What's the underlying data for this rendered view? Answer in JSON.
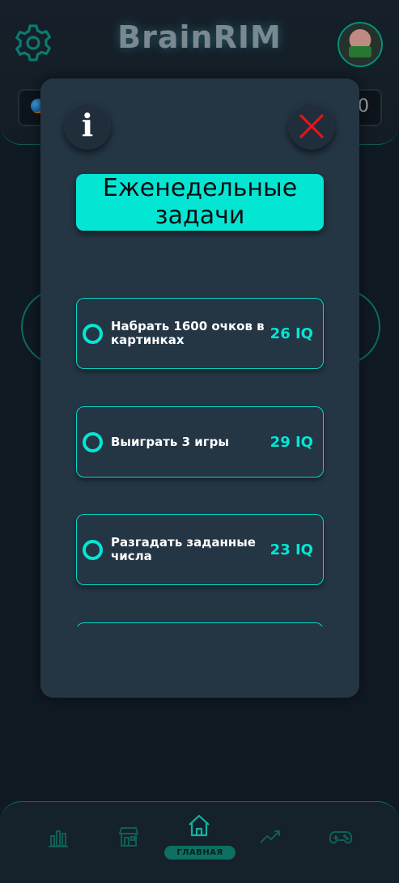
{
  "app": {
    "title": "BrainRIM"
  },
  "header": {
    "settings_icon": "gear-icon",
    "stat_right_value": "0"
  },
  "modal": {
    "title": "Еженедельные\nзадачи",
    "info_glyph": "i",
    "close_icon": "close-x-icon",
    "tasks": [
      {
        "label": "Набрать 1600 очков в картинках",
        "reward": "26 IQ"
      },
      {
        "label": "Выиграть 3 игры",
        "reward": "29 IQ"
      },
      {
        "label": "Разгадать заданные числа",
        "reward": "23 IQ"
      }
    ]
  },
  "nav": {
    "active_label": "ГЛАВНАЯ",
    "items": [
      "stats-icon",
      "shop-icon",
      "home-icon",
      "trend-icon",
      "gamepad-icon"
    ]
  },
  "colors": {
    "accent": "#04e6d4",
    "close": "#e0161b",
    "background": "#101a23",
    "modal": "#243544"
  }
}
